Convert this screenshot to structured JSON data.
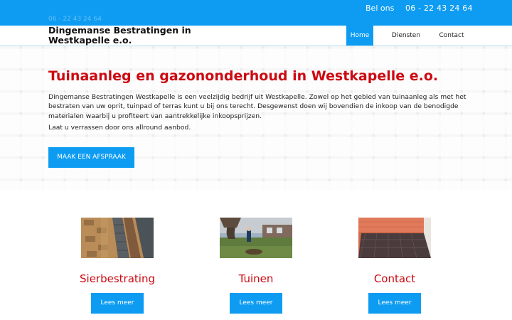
{
  "topbar": {
    "ghost_phone": "06 - 22 43 24 64",
    "call_label": "Bel ons",
    "phone": "06 - 22 43 24 64"
  },
  "header": {
    "brand": "Dingemanse Bestratingen in Westkapelle e.o.",
    "nav": [
      {
        "label": "Home",
        "active": true
      },
      {
        "label": "Diensten",
        "active": false
      },
      {
        "label": "Contact",
        "active": false
      }
    ]
  },
  "hero": {
    "title": "Tuinaanleg en gazononderhoud in Westkapelle e.o.",
    "text": "Dingemanse Bestratingen Westkapelle is een veelzijdig bedrijf uit Westkapelle. Zowel op het gebied van tuinaanleg als met het bestraten van uw oprit, tuinpad of terras kunt u bij ons terecht. Desgewenst doen wij bovendien de inkoop van de benodigde materialen waarbij u profiteert van aantrekkelijke inkoopsprijzen.",
    "text2": "Laat u verrassen door ons allround aanbod.",
    "cta": "Maak een afspraak"
  },
  "cards": [
    {
      "title": "Sierbestrating",
      "button": "Lees meer",
      "image": "paving-stones-photo"
    },
    {
      "title": "Tuinen",
      "button": "Lees meer",
      "image": "garden-tree-photo"
    },
    {
      "title": "Contact",
      "button": "Lees meer",
      "image": "tiled-terrace-photo"
    }
  ],
  "colors": {
    "accent_blue": "#0e9cf2",
    "title_red": "#cc0a12"
  }
}
